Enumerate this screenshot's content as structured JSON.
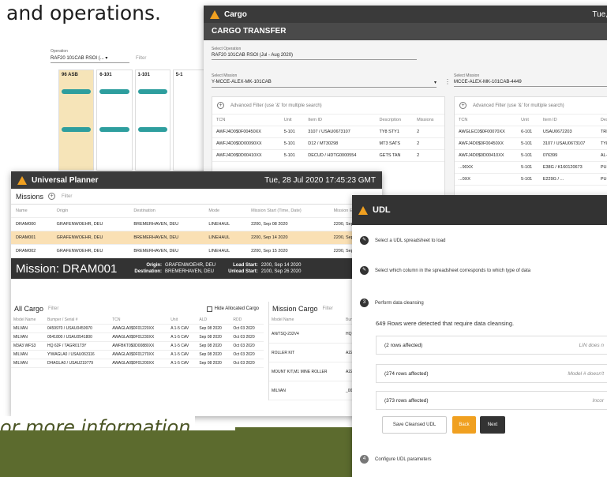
{
  "headline": "and operations.",
  "footer_text": "or more information",
  "colors": {
    "accent": "#f0a020",
    "dark": "#333333",
    "highlight": "#fae0b4",
    "olive": "#5c6b2e",
    "teal": "#2e9e9e"
  },
  "cargo": {
    "title": "Cargo",
    "time": "Tue,",
    "subtitle": "CARGO TRANSFER",
    "operation_label": "Select Operation",
    "operation_value": "RAF20 101CAB RSOI (Jul - Aug 2020)",
    "mission_left_label": "Select Mission",
    "mission_left_value": "Y-MCCE-ALEX-MK-101CAB",
    "mission_right_label": "Select Mission",
    "mission_right_value": "MCCE-ALEX-MK-101CAB-4449",
    "filter_placeholder": "Advanced Filter (use '&' for multiple search)",
    "left_columns": [
      "TCN",
      "Unit",
      "Item ID",
      "Description",
      "Missions"
    ],
    "left_rows": [
      [
        "AWFJ4D0$0F00450XX",
        "5-101",
        "3107 / USAU0673107",
        "TY8 STY1",
        "2"
      ],
      [
        "AWFJ4D0$0D00090XX",
        "5-101",
        "D12 / MT30298",
        "MT3 SATS",
        "2"
      ],
      [
        "AWFJ4D0$0D00410XX",
        "5-101",
        "DECUD / HDTG0000554",
        "GETS TAN",
        "2"
      ]
    ],
    "right_columns": [
      "TCN",
      "Unit",
      "Item ID",
      "Des"
    ],
    "right_rows": [
      [
        "AWGLEC0$0F00070XX",
        "6-101",
        "USAU0672203",
        "TRI"
      ],
      [
        "AWFJ4D0$0F00450XX",
        "5-101",
        "3107 / USAU0673107",
        "TY8"
      ],
      [
        "AWFJ4D0$0D00410XX",
        "5-101",
        "076399",
        "AL-"
      ],
      [
        "...90XX",
        "5-101",
        "E38G / K160120673",
        "PU-"
      ],
      [
        "...0XX",
        "5-101",
        "E229G / ...",
        "PU-"
      ]
    ]
  },
  "ops": {
    "operation_label": "Operation",
    "operation_value": "RAF20 101CAB RSOI (...",
    "filter": "Filter",
    "cards": [
      "96 ASB",
      "6-101",
      "1-101",
      "5-1"
    ]
  },
  "planner": {
    "title": "Universal Planner",
    "datetime": "Tue, 28 Jul 2020 17:45:23 GMT",
    "missions_title": "Missions",
    "filter": "Filter",
    "columns": [
      "Name",
      "Origin",
      "Destination",
      "Mode",
      "Mission Start (Time, Date)",
      "Mission End (T"
    ],
    "rows": [
      [
        "DRAM000",
        "GRAFENWOEHR, DEU",
        "BREMERHAVEN, DEU",
        "LINEHAUL",
        "2200, Sep 08 2020",
        "2200, Sep 20"
      ],
      [
        "DRAM001",
        "GRAFENWOEHR, DEU",
        "BREMERHAVEN, DEU",
        "LINEHAUL",
        "2200, Sep 14 2020",
        "2200, Sep 26"
      ],
      [
        "DRAM002",
        "GRAFENWOEHR, DEU",
        "BREMERHAVEN, DEU",
        "LINEHAUL",
        "2200, Sep 15 2020",
        "2200, Sep 27"
      ]
    ],
    "mission_title": "Mission: DRAM001",
    "origin_label": "Origin:",
    "origin_value": "GRAFENWOEHR, DEU",
    "destination_label": "Destination:",
    "destination_value": "BREMERHAVEN, DEU",
    "load_label": "Load Start:",
    "load_value": "2200, Sep 14 2020",
    "unload_label": "Unload Start:",
    "unload_value": "2100, Sep 26 2020",
    "all_cargo_title": "All Cargo",
    "hide_allocated": "Hide Allocated Cargo",
    "all_cargo_columns": [
      "Model Name",
      "Bumper / Serial #",
      "TCN",
      "Unit",
      "ALD",
      "RDD"
    ],
    "all_cargo_rows": [
      [
        "MILVAN",
        "0459970 / USAU0459970",
        "AWAGLA0$0F01220XX",
        "A 1-5 CAV",
        "Sep 08 2020",
        "Oct 03 2020"
      ],
      [
        "MILVAN",
        "0541800 / USAU0541800",
        "AWAGLA0$0F01230XX",
        "A 1-5 CAV",
        "Sep 08 2020",
        "Oct 03 2020"
      ],
      [
        "M3A3 WFS3",
        "HQ 62F / TAGR0173Y",
        "AWFBKT0$0D00880XX",
        "A 1-5 CAV",
        "Sep 08 2020",
        "Oct 03 2020"
      ],
      [
        "MILVAN",
        "Y!WAGLA0 / USAU063116",
        "AWAGLA0$0F01270XX",
        "A 1-5 CAV",
        "Sep 08 2020",
        "Oct 03 2020"
      ],
      [
        "MILVAN",
        "DHAGLA0 / USAU219779",
        "AWAGLA0$0F01200XX",
        "A 1-5 CAV",
        "Sep 08 2020",
        "Oct 03 2020"
      ]
    ],
    "mission_cargo_title": "Mission Cargo",
    "mission_cargo_columns": [
      "Model Name",
      "Bumper / S"
    ],
    "mission_cargo_rows": [
      [
        "AN/TSQ-232V4",
        "HQ 77 / ..."
      ],
      [
        "ROLLER KIT",
        "A22 / 033..."
      ],
      [
        "MOUNT K/T,M1 MINE ROLLER",
        "A22 / WA MTG01"
      ],
      [
        "MILVAN",
        "_006794..."
      ]
    ]
  },
  "udl": {
    "title": "UDL",
    "step1": "Select a UDL spreadsheet to load",
    "step2": "Select which column in the spreadsheet corresponds to which type of data",
    "step3_num": "3",
    "step3": "Perform data cleansing",
    "rows_detected": "649 Rows were detected that require data cleansing.",
    "affected": [
      {
        "count": "(2 rows affected)",
        "reason": "LIN does n"
      },
      {
        "count": "(274 rows affected)",
        "reason": "Model # doesn't"
      },
      {
        "count": "(373 rows affected)",
        "reason": "Incor"
      }
    ],
    "save_label": "Save Cleansed UDL",
    "back_label": "Back",
    "next_label": "Next",
    "step4_num": "4",
    "step4": "Configure UDL parameters"
  }
}
